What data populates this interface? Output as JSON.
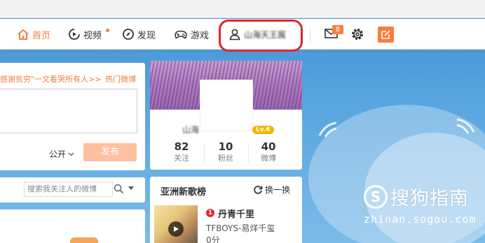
{
  "colors": {
    "accent": "#fa7d3c",
    "highlight_ring": "#e0262a",
    "level_badge": "#f5b400",
    "send_disabled": "#ffc09f"
  },
  "nav": {
    "home": {
      "label": "首页",
      "icon": "home-icon"
    },
    "video": {
      "label": "视频",
      "icon": "video-icon"
    },
    "discover": {
      "label": "发现",
      "icon": "compass-icon"
    },
    "games": {
      "label": "游戏",
      "icon": "gamepad-icon"
    },
    "user": {
      "label": "山海天王属",
      "icon": "user-icon"
    },
    "messages": {
      "icon": "mail-icon",
      "badge": "8"
    },
    "settings": {
      "icon": "gear-icon"
    },
    "compose": {
      "icon": "edit-icon"
    }
  },
  "publish": {
    "topic": "感谢贫穷\"一文看哭所有人>>",
    "hot_link": "热门微博",
    "visibility": "公开",
    "send_label": "发布"
  },
  "profile": {
    "name": "山海",
    "level": "Lv.6",
    "stats": [
      {
        "value": "82",
        "label": "关注"
      },
      {
        "value": "10",
        "label": "粉丝"
      },
      {
        "value": "40",
        "label": "微博"
      }
    ]
  },
  "search": {
    "placeholder": "搜索我关注人的微博"
  },
  "music_chart": {
    "title": "亚洲新歌榜",
    "refresh_label": "换一换",
    "songs": [
      {
        "rank": "1",
        "title": "丹青千里",
        "artist": "TFBOYS-易烊千玺",
        "score": "0分"
      }
    ]
  },
  "watermark": {
    "brand": "搜狗指南",
    "url": "zhinan.sogou.com",
    "logo_letter": "S"
  }
}
